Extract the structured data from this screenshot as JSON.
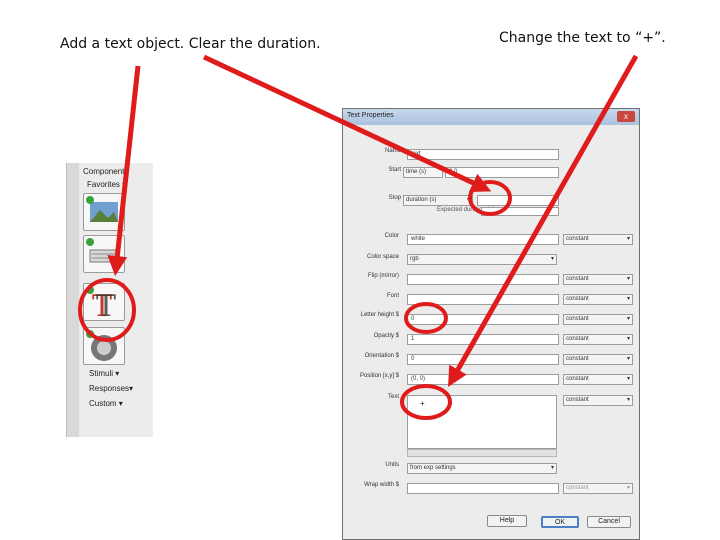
{
  "captions": {
    "left": "Add a text object.  Clear the duration.",
    "right": "Change the text to “+”."
  },
  "components": {
    "header": "Components",
    "favorites": "Favorites ▾",
    "stimuli": "Stimuli ▾",
    "responses": "Responses▾",
    "custom": "Custom ▾"
  },
  "dialog": {
    "title": "Text Properties",
    "close": "x",
    "fields": {
      "name": {
        "label": "Name",
        "value": "text"
      },
      "start": {
        "label": "Start",
        "type": "time (s)",
        "value": "0.0"
      },
      "stop": {
        "label": "Stop",
        "type": "duration (s)",
        "note": "Expected duration (s)"
      },
      "color": {
        "label": "Color",
        "value": "white",
        "mode": "constant"
      },
      "colorspace": {
        "label": "Color space",
        "value": "rgb"
      },
      "flip": {
        "label": "Flip (mirror)",
        "mode": "constant"
      },
      "font": {
        "label": "Font",
        "mode": "constant"
      },
      "letter_height": {
        "label": "Letter height $",
        "value": "0",
        "mode": "constant"
      },
      "opacity": {
        "label": "Opacity $",
        "value": "1",
        "mode": "constant"
      },
      "orientation": {
        "label": "Orientation $",
        "value": "0",
        "mode": "constant"
      },
      "position": {
        "label": "Position [x,y] $",
        "value": "(0, 0)",
        "mode": "constant"
      },
      "text": {
        "label": "Text",
        "value": "+",
        "mode": "constant"
      },
      "units": {
        "label": "Units",
        "value": "from exp settings"
      },
      "wrap": {
        "label": "Wrap width $",
        "mode": "constant"
      }
    },
    "buttons": {
      "help": "Help",
      "ok": "OK",
      "cancel": "Cancel"
    }
  },
  "colors": {
    "annotation": "#e01b1b",
    "titlebar": "#a9c1df"
  }
}
